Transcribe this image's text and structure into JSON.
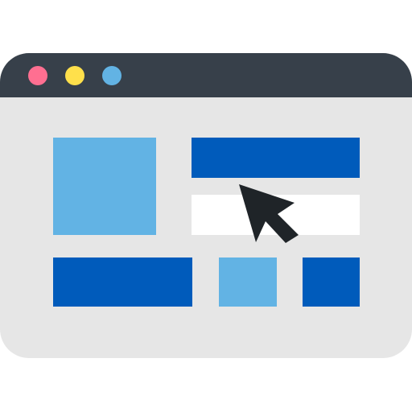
{
  "icon": {
    "name": "browser-window-cursor-icon",
    "colors": {
      "title_bar": "#37404A",
      "window_body": "#E6E6E6",
      "dot_red": "#FF6F91",
      "dot_yellow": "#FFE04B",
      "dot_blue": "#62B3E4",
      "block_light_blue": "#62B3E4",
      "block_dark_blue": "#005BBB",
      "block_white": "#FFFFFF",
      "cursor": "#1F2428"
    }
  }
}
